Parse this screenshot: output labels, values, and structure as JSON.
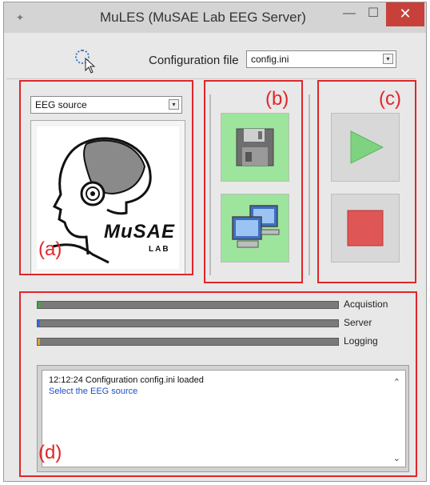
{
  "window": {
    "title": "MuLES (MuSAE Lab EEG Server)",
    "minimize_glyph": "—",
    "maximize_glyph": "☐",
    "close_glyph": "✕"
  },
  "config": {
    "label": "Configuration file",
    "value": "config.ini"
  },
  "eeg": {
    "selected": "EEG source",
    "logo_text": "MuSAE",
    "logo_sub": "LAB"
  },
  "annotations": {
    "a": "(a)",
    "b": "(b)",
    "c": "(c)",
    "d": "(d)"
  },
  "buttons": {
    "save": {
      "icon": "floppy-disk-icon",
      "color": "#9de49d"
    },
    "server": {
      "icon": "networked-computers-icon",
      "color": "#9de49d"
    },
    "play": {
      "icon": "play-icon",
      "color": "#d8d8d8"
    },
    "stop": {
      "icon": "stop-icon",
      "color": "#d8d8d8"
    }
  },
  "status": {
    "acquisition": {
      "label": "Acquistion",
      "progress": 0.0,
      "color": "#2fb52f"
    },
    "server": {
      "label": "Server",
      "progress": 0.0,
      "color": "#2f6fe0"
    },
    "logging": {
      "label": "Logging",
      "progress": 0.0,
      "color": "#e0a02f"
    }
  },
  "log": {
    "line1": "12:12:24  Configuration config.ini loaded",
    "line2": "Select the EEG source"
  },
  "colors": {
    "annotation_red": "#e0262a",
    "log_link": "#1e4fc8"
  }
}
